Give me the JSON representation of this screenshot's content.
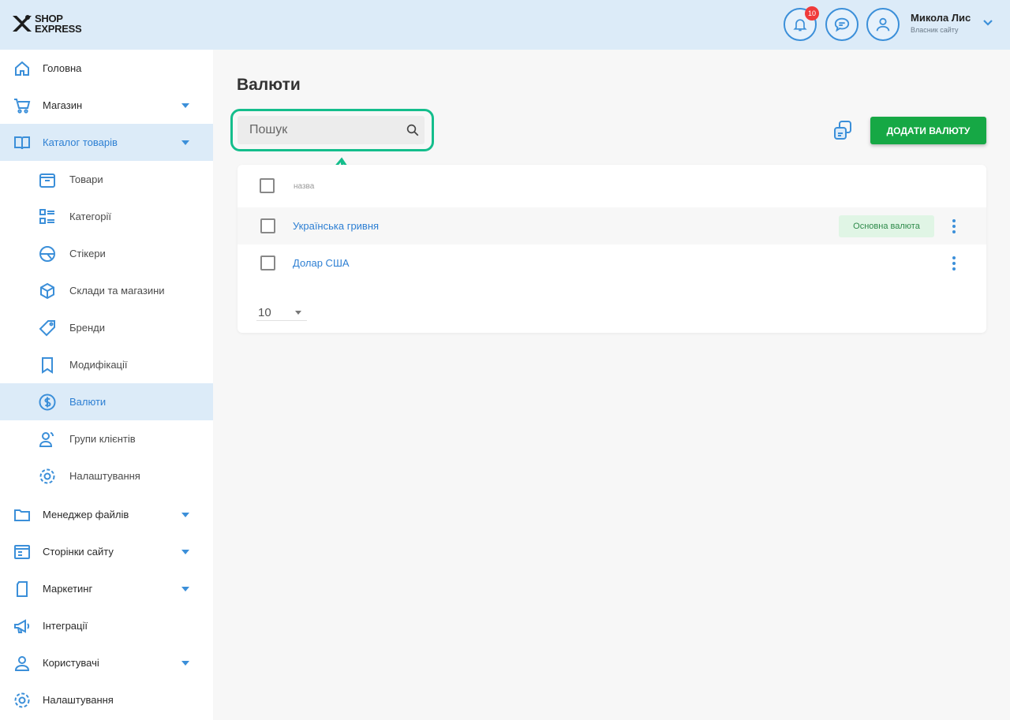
{
  "app": {
    "logo_line1": "SHOP",
    "logo_line2": "EXPRESS"
  },
  "header": {
    "notifications_count": "10",
    "user_name": "Микола Лис",
    "user_subtitle": "Власник сайту"
  },
  "sidebar": {
    "items": [
      {
        "label": "Головна",
        "icon": "home-icon"
      },
      {
        "label": "Магазин",
        "icon": "cart-icon"
      },
      {
        "label": "Каталог товарів",
        "icon": "book-icon"
      },
      {
        "label": "Товари",
        "icon": "box-icon"
      },
      {
        "label": "Категорії",
        "icon": "list-icon"
      },
      {
        "label": "Стікери",
        "icon": "sticker-icon"
      },
      {
        "label": "Склади та магазини",
        "icon": "cube-icon"
      },
      {
        "label": "Бренди",
        "icon": "tag-icon"
      },
      {
        "label": "Модифікації",
        "icon": "bookmark-icon"
      },
      {
        "label": "Валюти",
        "icon": "dollar-icon"
      },
      {
        "label": "Групи клієнтів",
        "icon": "users-icon"
      },
      {
        "label": "Налаштування",
        "icon": "gear-icon"
      },
      {
        "label": "Менеджер файлів",
        "icon": "folder-icon"
      },
      {
        "label": "Сторінки сайту",
        "icon": "page-icon"
      },
      {
        "label": "Маркетинг",
        "icon": "marketing-icon"
      },
      {
        "label": "Інтеграції",
        "icon": "megaphone-icon"
      },
      {
        "label": "Користувачі",
        "icon": "user-icon"
      },
      {
        "label": "Налаштування",
        "icon": "gear-icon"
      }
    ]
  },
  "main": {
    "title": "Валюти",
    "search_placeholder": "Пошук",
    "add_button": "ДОДАТИ ВАЛЮТУ",
    "table": {
      "header_name": "назва",
      "rows": [
        {
          "name": "Українська гривня",
          "badge": "Основна валюта"
        },
        {
          "name": "Долар США",
          "badge": ""
        }
      ]
    },
    "per_page": "10"
  },
  "colors": {
    "accent": "#3b8fd9",
    "highlight": "#14be8c",
    "add_button": "#16a845",
    "header_bg": "#dcebf8"
  }
}
